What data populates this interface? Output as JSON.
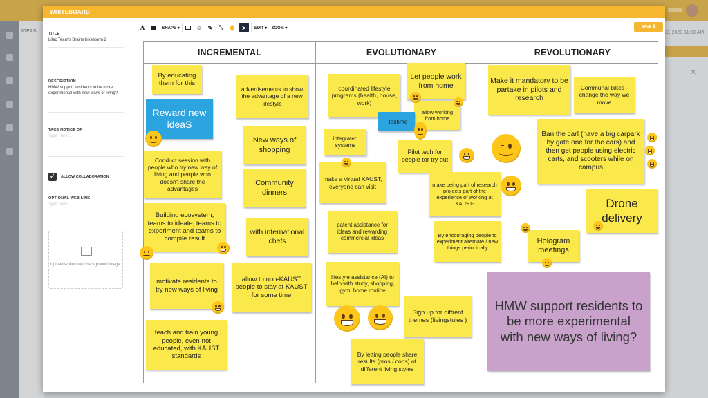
{
  "modal": {
    "title": "WHITEBOARD"
  },
  "form": {
    "title_label": "TITLE",
    "title_value": "Lilac Team's Brains bikestorm 2",
    "description_label": "DESCRIPTION",
    "description_value": "HMW support residents to be more experimental with new ways of living?",
    "notice_label": "TAKE NOTICE OF",
    "notice_placeholder": "Type Here...",
    "collab_label": "ALLOW COLLABORATION",
    "collab_checked": true,
    "weblink_label": "OPTIONAL WEB LINK",
    "weblink_placeholder": "Type Here...",
    "upload_text": "Upload whiteboard background image."
  },
  "toolbar": {
    "text_icon": "A",
    "shape_label": "SHAPE ▾",
    "edit_label": "EDIT ▾",
    "zoom_label": "ZOOM ▾",
    "save_label": "SAVE 🗎"
  },
  "background": {
    "left_label": "IDEAS",
    "right_date": "10, 2020 11:00 AM"
  },
  "board": {
    "columns": [
      "INCREMENTAL",
      "EVOLUTIONARY",
      "REVOLUTIONARY"
    ],
    "notes": [
      {
        "text": "By educating them for this"
      },
      {
        "text": "advertisements to show the advantage of a new lifestyle"
      },
      {
        "text": "Reward new ideaS"
      },
      {
        "text": "New ways of shopping"
      },
      {
        "text": "Conduct session with people who try new way of living and people who doesn't share the advantages"
      },
      {
        "text": "Community dinners"
      },
      {
        "text": "Building ecosystem, teams to ideate, teams to experiment and teams to compile result"
      },
      {
        "text": "with international chefs"
      },
      {
        "text": "motivate residents to try new ways of living"
      },
      {
        "text": "allow to non-KAUST people to stay at KAUST for some time"
      },
      {
        "text": "teach and train young people, even-not educated, with KAUST standards"
      },
      {
        "text": "coordinated lifestyle programs (health, house, work)"
      },
      {
        "text": "Let people work from home"
      },
      {
        "text": "allow working from home"
      },
      {
        "text": "Flextime"
      },
      {
        "text": "integrated systems"
      },
      {
        "text": "Pilot tech for people tor try out"
      },
      {
        "text": "make a virtual KAUST, everyone can visit"
      },
      {
        "text": "make being part of research projects part of the experience of working at KAUST-"
      },
      {
        "text": "patent assistance for ideas and rewarding commercial ideas"
      },
      {
        "text": "By encouraging people to experiment alternate / new things periodically"
      },
      {
        "text": "lifestyle assistance (AI) to help with study, shopping, gym, home routine"
      },
      {
        "text": "Sign up for diffrent themes (livingstules )"
      },
      {
        "text": "By letting people share results (pros / cons) of different living styles"
      },
      {
        "text": "Make it mandatory to be partake in pilots and research"
      },
      {
        "text": "Communal bikes - change the way we move"
      },
      {
        "text": "Ban the car! (have a big carpark by gate one for the cars) and then get people using electric carts, and scooters while on campus"
      },
      {
        "text": "Drone delivery"
      },
      {
        "text": "Hologram meetings"
      },
      {
        "text": "HMW support residents to be more experimental with new ways of living?"
      }
    ]
  },
  "colors": {
    "accent": "#f5b630",
    "sticky_yellow": "#fbe84a",
    "sticky_blue": "#2ba4df",
    "sticky_purple": "#c9a2cc"
  }
}
